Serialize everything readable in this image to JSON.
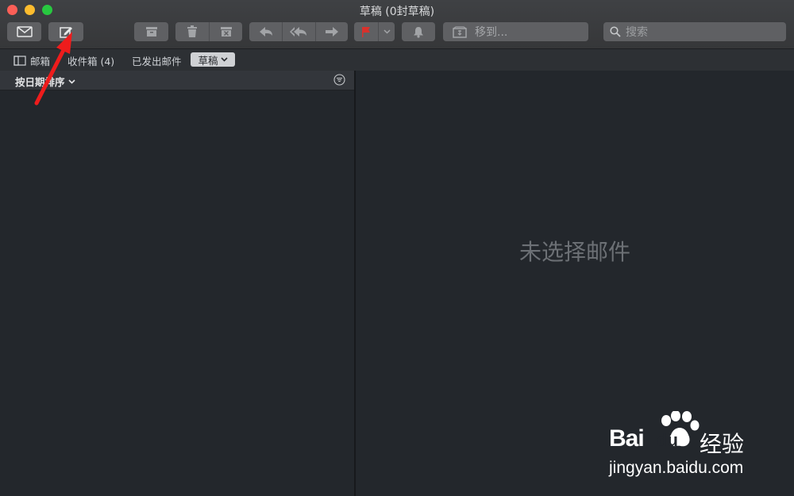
{
  "window": {
    "title": "草稿 (0封草稿)"
  },
  "toolbar": {
    "move_to_placeholder": "移到...",
    "search_placeholder": "搜索"
  },
  "favorites": {
    "mailboxes_label": "邮箱",
    "inbox_label": "收件箱 (4)",
    "sent_label": "已发出邮件",
    "drafts_label": "草稿"
  },
  "message_list": {
    "sort_label": "按日期排序"
  },
  "viewer": {
    "empty_message": "未选择邮件"
  },
  "watermark": {
    "brand_en": "Bai",
    "brand_du": "du",
    "brand_cn": "经验",
    "url": "jingyan.baidu.com"
  },
  "colors": {
    "flag": "#d8312c",
    "annotation_arrow": "#ee1c1c",
    "close": "#fc5f57",
    "minimize": "#fdbc2e",
    "maximize": "#28c840"
  }
}
